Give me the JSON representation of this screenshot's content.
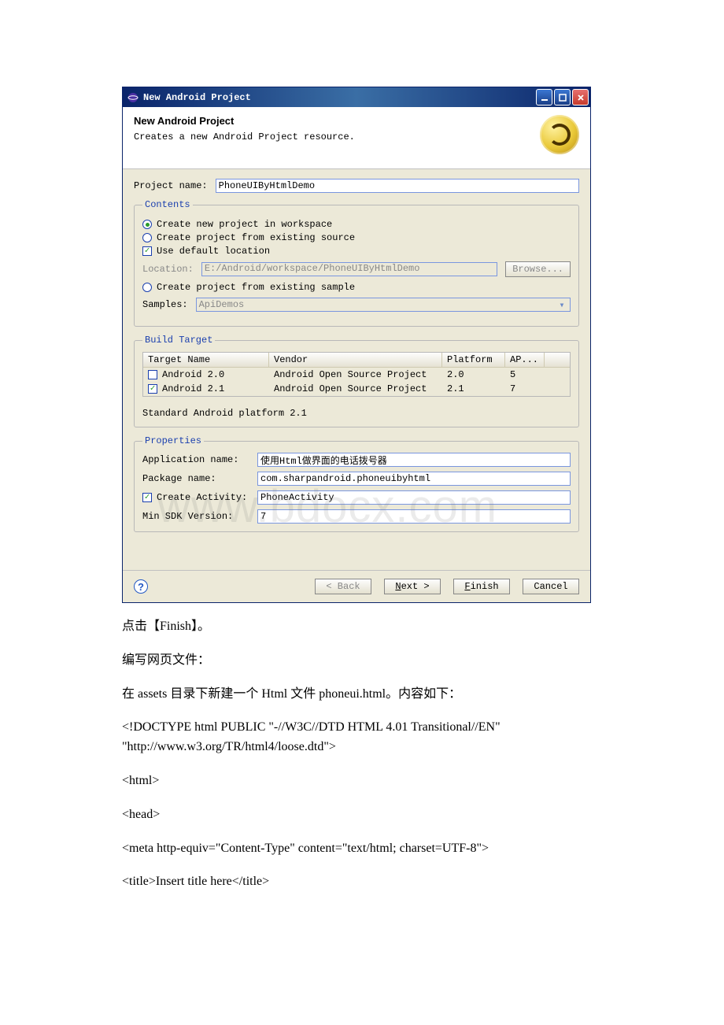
{
  "window": {
    "title": "New Android Project",
    "heading": "New Android Project",
    "subtitle": "Creates a new Android Project resource."
  },
  "project_name_label": "Project name:",
  "project_name_value": "PhoneUIByHtmlDemo",
  "contents": {
    "legend": "Contents",
    "radio_new": "Create new project in workspace",
    "radio_existing": "Create project from existing source",
    "cb_default": "Use default location",
    "location_label": "Location:",
    "location_value": "E:/Android/workspace/PhoneUIByHtmlDemo",
    "browse": "Browse...",
    "radio_sample": "Create project from existing sample",
    "samples_label": "Samples:",
    "samples_value": "ApiDemos"
  },
  "build_target": {
    "legend": "Build Target",
    "headers": {
      "name": "Target Name",
      "vendor": "Vendor",
      "platform": "Platform",
      "api": "AP..."
    },
    "rows": [
      {
        "checked": false,
        "name": "Android 2.0",
        "vendor": "Android Open Source Project",
        "platform": "2.0",
        "api": "5"
      },
      {
        "checked": true,
        "name": "Android 2.1",
        "vendor": "Android Open Source Project",
        "platform": "2.1",
        "api": "7"
      }
    ],
    "footer": "Standard Android platform 2.1"
  },
  "properties": {
    "legend": "Properties",
    "app_label": "Application name:",
    "app_value": "使用Html做界面的电话拨号器",
    "pkg_label": "Package name:",
    "pkg_value": "com.sharpandroid.phoneuibyhtml",
    "act_label": "Create Activity:",
    "act_value": "PhoneActivity",
    "sdk_label": "Min SDK Version:",
    "sdk_value": "7"
  },
  "buttons": {
    "back": "< Back",
    "next": "Next >",
    "finish": "Finish",
    "cancel": "Cancel"
  },
  "doc": {
    "p1": "点击【Finish】。",
    "p2": "编写网页文件：",
    "p3": "在 assets 目录下新建一个 Html 文件 phoneui.html。内容如下：",
    "p4": "<!DOCTYPE html PUBLIC \"-//W3C//DTD HTML 4.01 Transitional//EN\" \"http://www.w3.org/TR/html4/loose.dtd\">",
    "p5": "<html>",
    "p6": "<head>",
    "p7": "<meta http-equiv=\"Content-Type\" content=\"text/html; charset=UTF-8\">",
    "p8": "<title>Insert title here</title>"
  }
}
